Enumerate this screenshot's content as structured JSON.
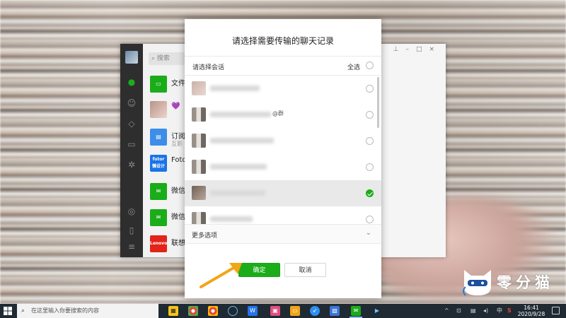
{
  "wechat_window": {
    "search_placeholder": "搜索",
    "items": [
      {
        "name": "文件传",
        "icon_color": "#1aad19",
        "icon": "folder-icon"
      },
      {
        "name": "💜",
        "icon_color": "#d6b5ac",
        "icon": "avatar"
      },
      {
        "name": "订阅号",
        "sub": "互影",
        "icon_color": "#3d8ee8",
        "icon": "subscription-icon"
      },
      {
        "name": "Foto",
        "icon_text": "fotor\n懒设计",
        "icon_color": "#1a74e8",
        "icon": "fotor-icon"
      },
      {
        "name": "微信",
        "icon_color": "#1aad19",
        "icon": "wechat-icon"
      },
      {
        "name": "微信",
        "icon_color": "#1aad19",
        "icon": "wechat-icon"
      },
      {
        "name": "联想",
        "icon_text": "Lenovo",
        "icon_color": "#e2231a",
        "icon": "lenovo-icon"
      }
    ]
  },
  "dialog": {
    "title": "请选择需要传输的聊天记录",
    "header_label": "请选择会话",
    "select_all_label": "全选",
    "chats": [
      {
        "name_tail": "",
        "selected": false,
        "avatar": "photo"
      },
      {
        "name_tail": "@群",
        "selected": false,
        "avatar": "grid"
      },
      {
        "name_tail": "",
        "selected": false,
        "avatar": "grid"
      },
      {
        "name_tail": "",
        "selected": false,
        "avatar": "grid"
      },
      {
        "name_tail": "",
        "selected": true,
        "avatar": "grid"
      },
      {
        "name_tail": "",
        "selected": false,
        "avatar": "grid"
      }
    ],
    "more_options_label": "更多选项",
    "ok_label": "确定",
    "cancel_label": "取消"
  },
  "watermark": {
    "text": "零分猫"
  },
  "taskbar": {
    "search_placeholder": "在这里输入你要搜索的内容",
    "tray_lang": "中",
    "clock_time": "16:41",
    "clock_date": "2020/9/28"
  },
  "colors": {
    "accent": "#1aad19",
    "taskbar": "#1f2a33",
    "arrow": "#f2a516"
  }
}
